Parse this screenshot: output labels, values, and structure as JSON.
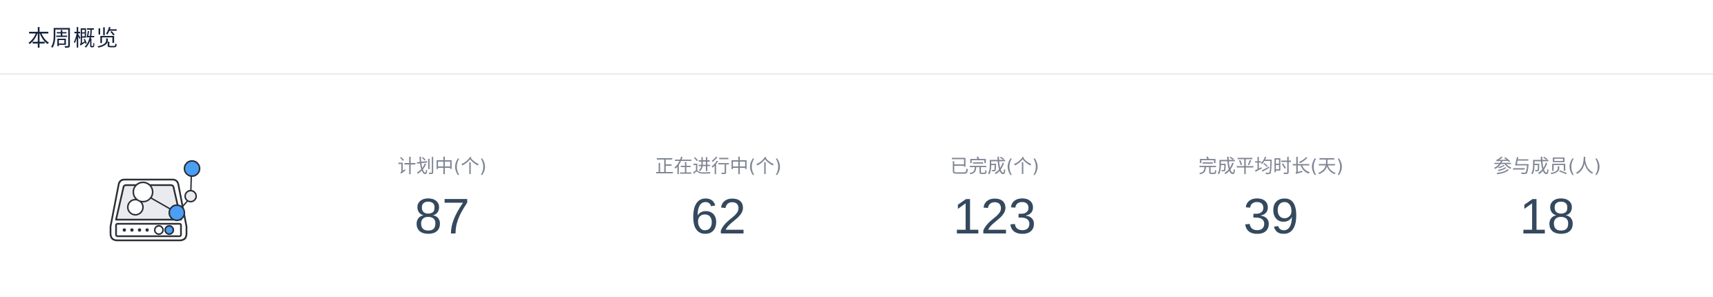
{
  "header": {
    "title": "本周概览"
  },
  "stats": [
    {
      "label": "计划中(个)",
      "value": "87"
    },
    {
      "label": "正在进行中(个)",
      "value": "62"
    },
    {
      "label": "已完成(个)",
      "value": "123"
    },
    {
      "label": "完成平均时长(天)",
      "value": "39"
    },
    {
      "label": "参与成员(人)",
      "value": "18"
    }
  ],
  "illustration": {
    "icon": "network-drive-icon"
  },
  "colors": {
    "title": "#17233d",
    "label": "#808695",
    "value": "#34495e",
    "accent": "#4a9ff5",
    "divider": "#e8eaec"
  }
}
